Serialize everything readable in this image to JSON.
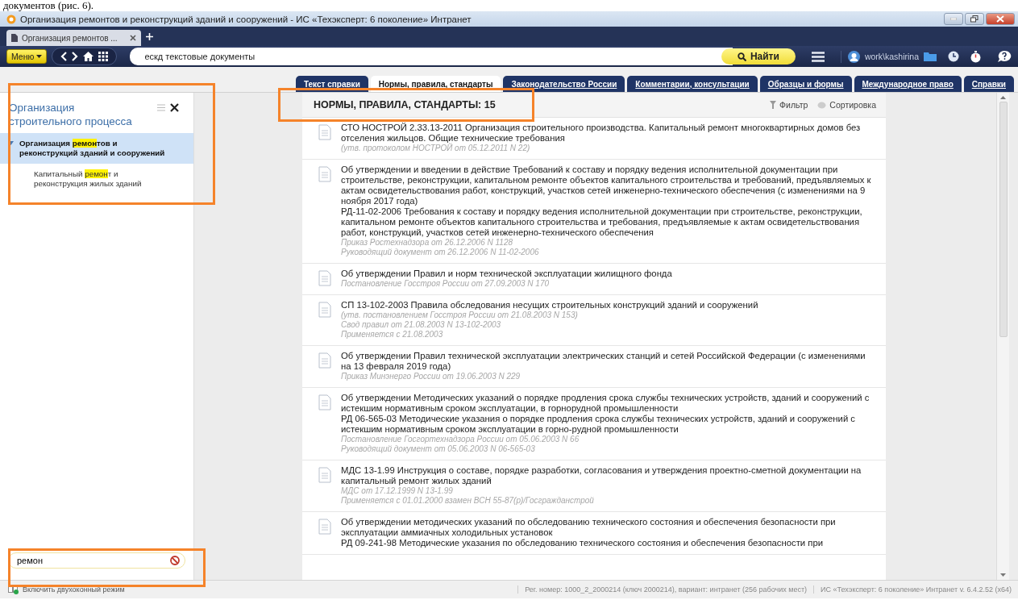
{
  "page_caption": "документов (рис. 6).",
  "window": {
    "title": "Организация ремонтов и реконструкций зданий и сооружений - ИС «Техэксперт: 6 поколение» Интранет"
  },
  "browser_tabs": [
    {
      "label": "Организация ремонтов ...",
      "selected": true
    }
  ],
  "toolbar": {
    "menu": "Меню",
    "query": "ескд текстовые документы",
    "find_button": "Найти",
    "user": "work\\kashirina"
  },
  "section_tabs": [
    {
      "label": "Текст справки",
      "selected": false
    },
    {
      "label": "Нормы, правила, стандарты",
      "selected": true
    },
    {
      "label": "Законодательство России",
      "selected": false
    },
    {
      "label": "Комментарии, консультации",
      "selected": false
    },
    {
      "label": "Образцы и формы",
      "selected": false
    },
    {
      "label": "Международное право",
      "selected": false
    },
    {
      "label": "Справки",
      "selected": false
    }
  ],
  "sidebar": {
    "title": "Организация строительного процесса",
    "tree": [
      {
        "before": "Организация ",
        "match": "ремон",
        "after": "тов и реконструкций зданий и сооружений",
        "expanded": true,
        "selected": true,
        "children": [
          {
            "before": "Капитальный ",
            "match": "ремон",
            "after": "т и реконструкция жилых зданий",
            "selected": false
          }
        ]
      }
    ],
    "filter_value": "ремон"
  },
  "results": {
    "heading": "НОРМЫ, ПРАВИЛА, СТАНДАРТЫ: 15",
    "filter": "Фильтр",
    "sort": "Сортировка",
    "documents": [
      {
        "texts": [
          "СТО НОСТРОЙ 2.33.13-2011 Организация строительного производства. Капитальный ремонт многоквартирных домов без отселения жильцов. Общие технические требования"
        ],
        "notes": [
          "(утв. протоколом НОСТРОЙ от 05.12.2011 N 22)"
        ]
      },
      {
        "texts": [
          "Об утверждении и введении в действие Требований к составу и порядку ведения исполнительной документации при строительстве, реконструкции, капитальном ремонте объектов капитального строительства и требований, предъявляемых к актам освидетельствования работ, конструкций, участков сетей инженерно-технического обеспечения (с изменениями на 9 ноября 2017 года)",
          "РД-11-02-2006 Требования к составу и порядку ведения исполнительной документации при строительстве, реконструкции, капитальном ремонте объектов капитального строительства и требования, предъявляемые к актам освидетельствования работ, конструкций, участков сетей инженерно-технического обеспечения"
        ],
        "notes": [
          "Приказ Ростехнадзора от 26.12.2006 N 1128",
          "Руководящий документ от 26.12.2006 N 11-02-2006"
        ]
      },
      {
        "texts": [
          "Об утверждении Правил и норм технической эксплуатации жилищного фонда"
        ],
        "notes": [
          "Постановление Госстроя России от 27.09.2003 N 170"
        ]
      },
      {
        "texts": [
          "СП 13-102-2003 Правила обследования несущих строительных конструкций зданий и сооружений"
        ],
        "notes": [
          "(утв. постановлением Госстроя России от 21.08.2003 N 153)",
          "Свод правил от 21.08.2003 N 13-102-2003",
          "Применяется с 21.08.2003"
        ]
      },
      {
        "texts": [
          "Об утверждении Правил технической эксплуатации электрических станций и сетей Российской Федерации (с изменениями на 13 февраля 2019 года)"
        ],
        "notes": [
          "Приказ Минэнерго России от 19.06.2003 N 229"
        ]
      },
      {
        "texts": [
          "Об утверждении Методических указаний о порядке продления срока службы технических устройств, зданий и сооружений с истекшим нормативным сроком эксплуатации, в горнорудной промышленности",
          "РД 06-565-03 Методические указания о порядке продления срока службы технических устройств, зданий и сооружений с истекшим нормативным сроком эксплуатации в горно-рудной промышленности"
        ],
        "notes": [
          "Постановление Госгортехнадзора России от 05.06.2003 N 66",
          "Руководящий документ от 05.06.2003 N 06-565-03"
        ]
      },
      {
        "texts": [
          "МДС 13-1.99 Инструкция о составе, порядке разработки, согласования и утверждения проектно-сметной документации на капитальный ремонт жилых зданий"
        ],
        "notes": [
          "МДС от 17.12.1999 N 13-1.99",
          "Применяется с 01.01.2000 взамен ВСН 55-87(р)/Госгражданстрой"
        ]
      },
      {
        "texts": [
          "Об утверждении методических указаний по обследованию технического состояния и обеспечения безопасности при эксплуатации аммиачных холодильных установок",
          "РД 09-241-98 Методические указания по обследованию технического состояния и обеспечения безопасности при"
        ]
      }
    ]
  },
  "status_bar": {
    "two_window_link": "Включить двухоконный режим",
    "registration": "Рег. номер: 1000_2_2000214 (ключ 2000214), вариант: интранет (256 рабочих мест)",
    "version": "ИС «Техэксперт: 6 поколение» Интранет v. 6.4.2.52 (x64)"
  }
}
